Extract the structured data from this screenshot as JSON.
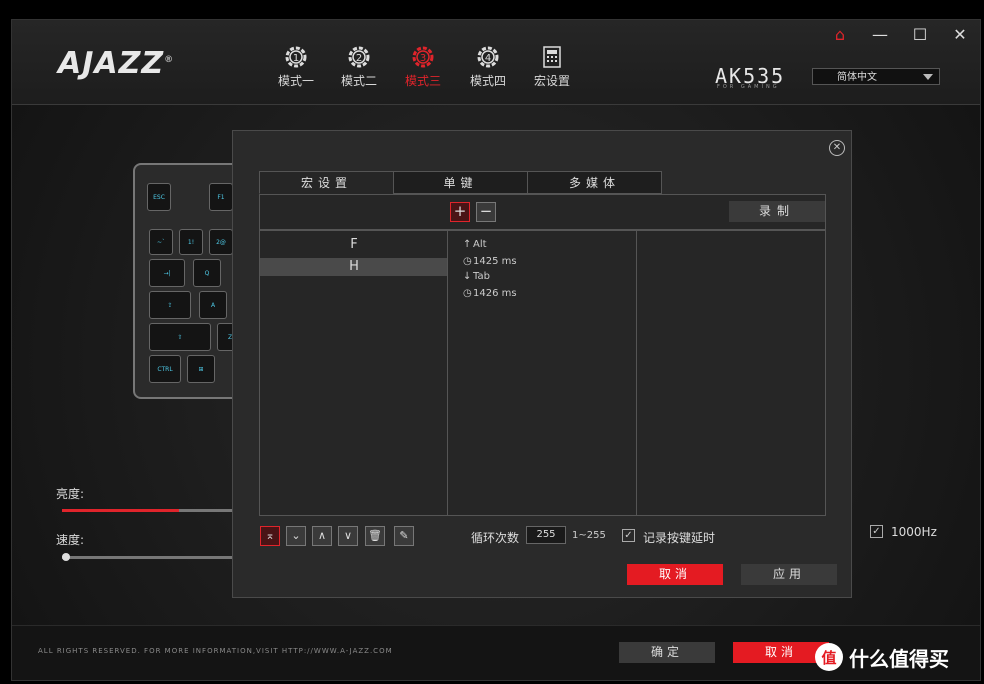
{
  "brand": {
    "logo": "AJAZZ",
    "reg": "®",
    "model": "AK535",
    "model_sub": "FOR GAMING"
  },
  "header": {
    "modes": [
      {
        "label": "模式一",
        "num": "1",
        "active": false
      },
      {
        "label": "模式二",
        "num": "2",
        "active": false
      },
      {
        "label": "模式三",
        "num": "3",
        "active": true
      },
      {
        "label": "模式四",
        "num": "4",
        "active": false
      },
      {
        "label": "宏设置",
        "num": "",
        "active": false
      }
    ],
    "language": "简体中文",
    "window_controls": [
      "home",
      "minimize",
      "maximize",
      "close"
    ]
  },
  "keyboard_preview": {
    "keys": [
      "ESC",
      "F1",
      "~`",
      "1!",
      "2@",
      "→|",
      "Q",
      "⇪",
      "A",
      "⇧",
      "Z",
      "CTRL",
      "⊞"
    ]
  },
  "sidebar": {
    "brightness_label": "亮度:",
    "speed_label": "速度:",
    "brightness_level": 0.65,
    "speed_level": 0.0
  },
  "polling": {
    "label": "1000Hz",
    "checked": true
  },
  "dialog": {
    "tabs": [
      "宏设置",
      "单键",
      "多媒体"
    ],
    "add_label": "+",
    "remove_label": "−",
    "record_label": "录制",
    "macros": [
      {
        "name": "F",
        "selected": false
      },
      {
        "name": "H",
        "selected": true
      }
    ],
    "events": [
      {
        "icon": "arrow-up",
        "glyph": "↑",
        "text": "Alt"
      },
      {
        "icon": "clock",
        "glyph": "◷",
        "text": "1425 ms"
      },
      {
        "icon": "arrow-down",
        "glyph": "↓",
        "text": "Tab"
      },
      {
        "icon": "clock",
        "glyph": "◷",
        "text": "1426 ms"
      }
    ],
    "loop_label": "循环次数",
    "loop_value": "255",
    "loop_range": "1~255",
    "record_delay_label": "记录按键延时",
    "record_delay_checked": true,
    "cancel_label": "取消",
    "apply_label": "应用"
  },
  "footer": {
    "copyright": "ALL RIGHTS RESERVED. FOR MORE INFORMATION,VISIT HTTP://WWW.A-JAZZ.COM",
    "ok_label": "确定",
    "cancel_label": "取消"
  },
  "watermark": {
    "icon": "值",
    "text": "什么值得买"
  },
  "colors": {
    "accent": "#e0242b",
    "bg": "#1b1b1b",
    "panel": "#262626"
  }
}
